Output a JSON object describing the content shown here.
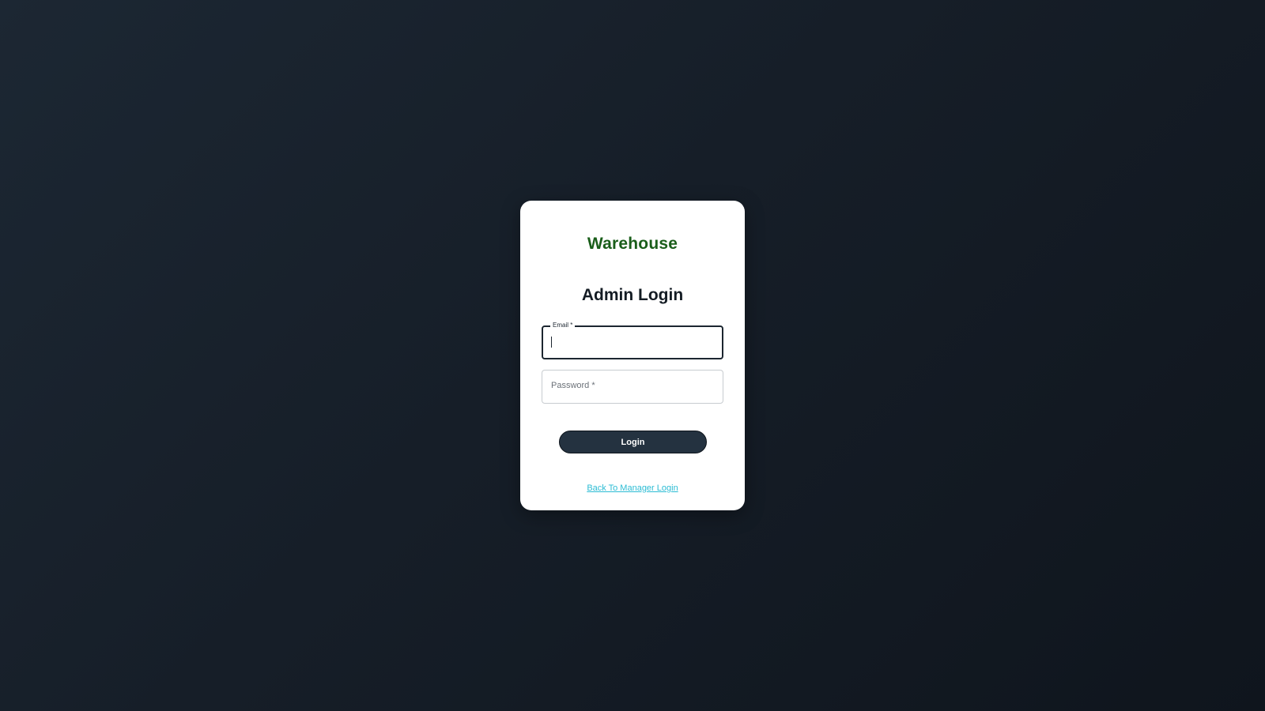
{
  "brand": {
    "name": "Warehouse",
    "color": "#1a5e1a"
  },
  "form": {
    "title": "Admin Login",
    "email": {
      "label": "Email *",
      "value": ""
    },
    "password": {
      "label": "Password *",
      "value": ""
    },
    "submit_label": "Login",
    "back_link_label": "Back To Manager Login"
  },
  "colors": {
    "background": "#161e28",
    "button": "#243240",
    "link": "#2bbcd4"
  }
}
